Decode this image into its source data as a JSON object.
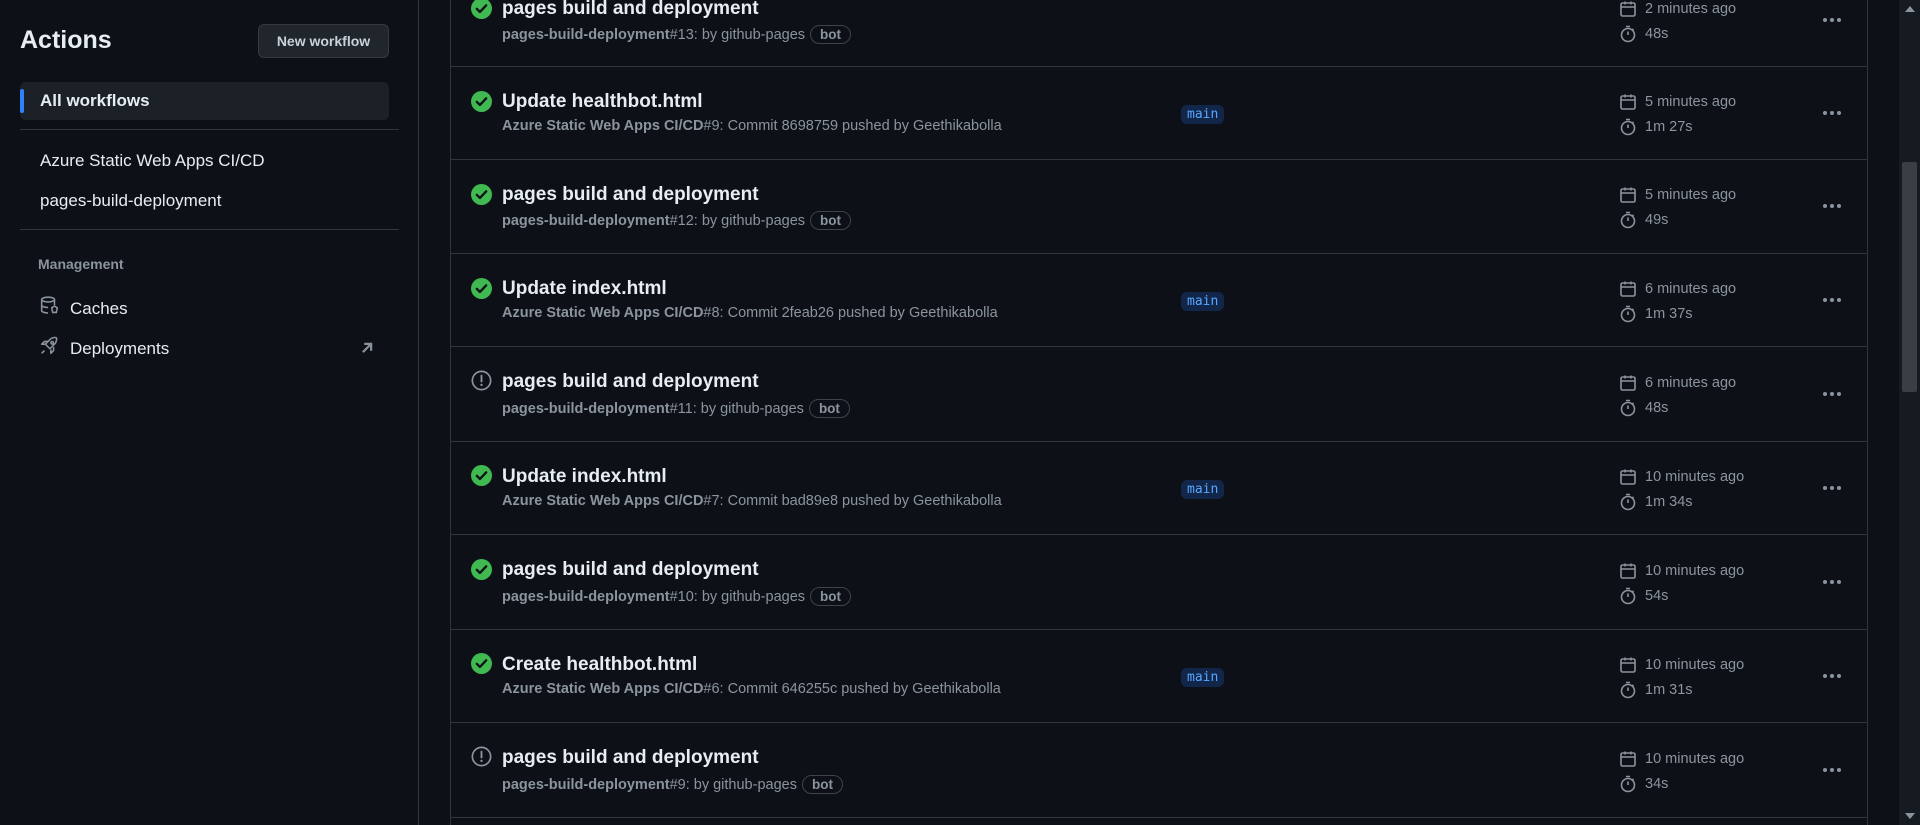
{
  "sidebar": {
    "title": "Actions",
    "new_workflow_label": "New workflow",
    "all_workflows_label": "All workflows",
    "workflows": [
      "Azure Static Web Apps CI/CD",
      "pages-build-deployment"
    ],
    "management_label": "Management",
    "caches_label": "Caches",
    "deployments_label": "Deployments"
  },
  "runs": [
    {
      "status": "success",
      "title": "pages build and deployment",
      "workflow": "pages-build-deployment",
      "rest": " #13: by github-pages",
      "bot": "bot",
      "branch": "",
      "when": "2 minutes ago",
      "duration": "48s"
    },
    {
      "status": "success",
      "title": "Update healthbot.html",
      "workflow": "Azure Static Web Apps CI/CD",
      "rest": " #9: Commit 8698759 pushed by Geethikabolla",
      "bot": "",
      "branch": "main",
      "when": "5 minutes ago",
      "duration": "1m 27s"
    },
    {
      "status": "success",
      "title": "pages build and deployment",
      "workflow": "pages-build-deployment",
      "rest": " #12: by github-pages",
      "bot": "bot",
      "branch": "",
      "when": "5 minutes ago",
      "duration": "49s"
    },
    {
      "status": "success",
      "title": "Update index.html",
      "workflow": "Azure Static Web Apps CI/CD",
      "rest": " #8: Commit 2feab26 pushed by Geethikabolla",
      "bot": "",
      "branch": "main",
      "when": "6 minutes ago",
      "duration": "1m 37s"
    },
    {
      "status": "neutral",
      "title": "pages build and deployment",
      "workflow": "pages-build-deployment",
      "rest": " #11: by github-pages",
      "bot": "bot",
      "branch": "",
      "when": "6 minutes ago",
      "duration": "48s"
    },
    {
      "status": "success",
      "title": "Update index.html",
      "workflow": "Azure Static Web Apps CI/CD",
      "rest": " #7: Commit bad89e8 pushed by Geethikabolla",
      "bot": "",
      "branch": "main",
      "when": "10 minutes ago",
      "duration": "1m 34s"
    },
    {
      "status": "success",
      "title": "pages build and deployment",
      "workflow": "pages-build-deployment",
      "rest": " #10: by github-pages",
      "bot": "bot",
      "branch": "",
      "when": "10 minutes ago",
      "duration": "54s"
    },
    {
      "status": "success",
      "title": "Create healthbot.html",
      "workflow": "Azure Static Web Apps CI/CD",
      "rest": " #6: Commit 646255c pushed by Geethikabolla",
      "bot": "",
      "branch": "main",
      "when": "10 minutes ago",
      "duration": "1m 31s"
    },
    {
      "status": "neutral",
      "title": "pages build and deployment",
      "workflow": "pages-build-deployment",
      "rest": " #9: by github-pages",
      "bot": "bot",
      "branch": "",
      "when": "10 minutes ago",
      "duration": "34s"
    }
  ],
  "colors": {
    "success": "#3fb950",
    "neutral": "#8b949e",
    "accent": "#2f81f7"
  }
}
